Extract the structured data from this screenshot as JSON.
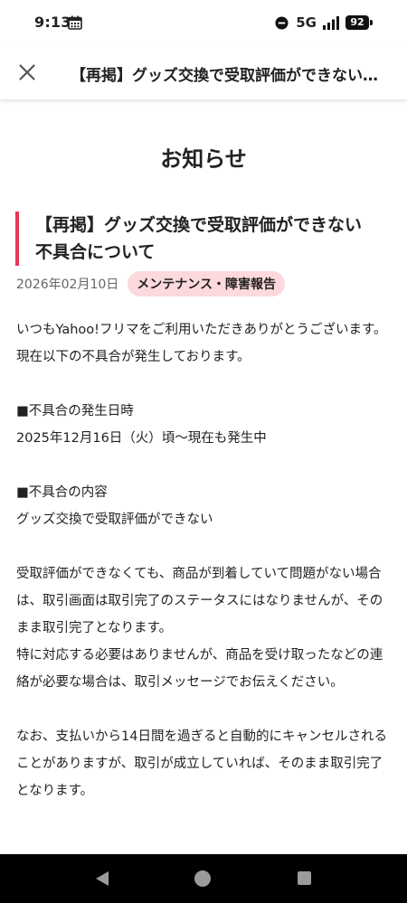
{
  "status_bar": {
    "time": "9:13",
    "network": "5G",
    "battery": "92"
  },
  "header": {
    "title": "【再掲】グッズ交換で受取評価ができない…"
  },
  "page": {
    "title": "お知らせ"
  },
  "article": {
    "title_lines": [
      "【再掲】グッズ交換で受取評価ができない",
      "不具合について"
    ],
    "date": "2026年02月10日",
    "category": "メンテナンス・障害報告",
    "body": [
      "いつもYahoo!フリマをご利用いただきありがとうございます。",
      "現在以下の不具合が発生しております。",
      "",
      "■不具合の発生日時",
      "2025年12月16日（火）頃〜現在も発生中",
      "",
      "■不具合の内容",
      "グッズ交換で受取評価ができない",
      "",
      "受取評価ができなくても、商品が到着していて問題がない場合は、取引画面は取引完了のステータスにはなりませんが、そのまま取引完了となります。",
      "特に対応する必要はありませんが、商品を受け取ったなどの連絡が必要な場合は、取引メッセージでお伝えください。",
      "",
      "なお、支払いから14日間を過ぎると自動的にキャンセルされることがありますが、取引が成立していれば、そのまま取引完了となります。"
    ]
  },
  "colors": {
    "accent": "#e8385a",
    "badge_bg": "#fcd9dc",
    "nav_bg": "#000000"
  },
  "icons": {
    "status": [
      "calendar-icon",
      "dnd-icon",
      "signal-icon",
      "battery-icon"
    ],
    "header": [
      "close-icon"
    ],
    "nav": [
      "back-icon",
      "home-icon",
      "recents-icon"
    ]
  }
}
